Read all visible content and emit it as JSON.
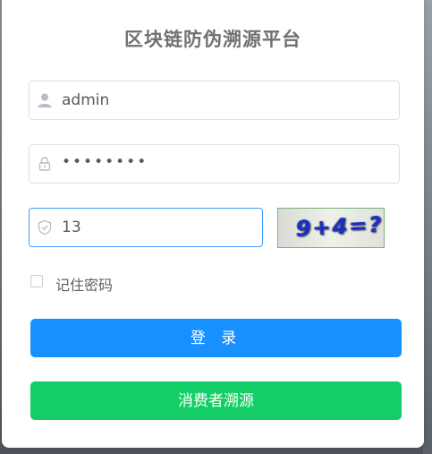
{
  "title": "区块链防伪溯源平台",
  "form": {
    "username": {
      "value": "admin",
      "icon": "user-icon"
    },
    "password": {
      "value": "••••••••",
      "icon": "lock-icon"
    },
    "captcha": {
      "value": "13",
      "icon": "shield-icon",
      "image_text": "9+4=?"
    },
    "remember_label": "记住密码",
    "remember_checked": false
  },
  "buttons": {
    "login_label": "登 录",
    "consumer_label": "消费者溯源"
  },
  "colors": {
    "primary": "#1890ff",
    "success": "#13ce66",
    "focus_border": "#409eff"
  }
}
